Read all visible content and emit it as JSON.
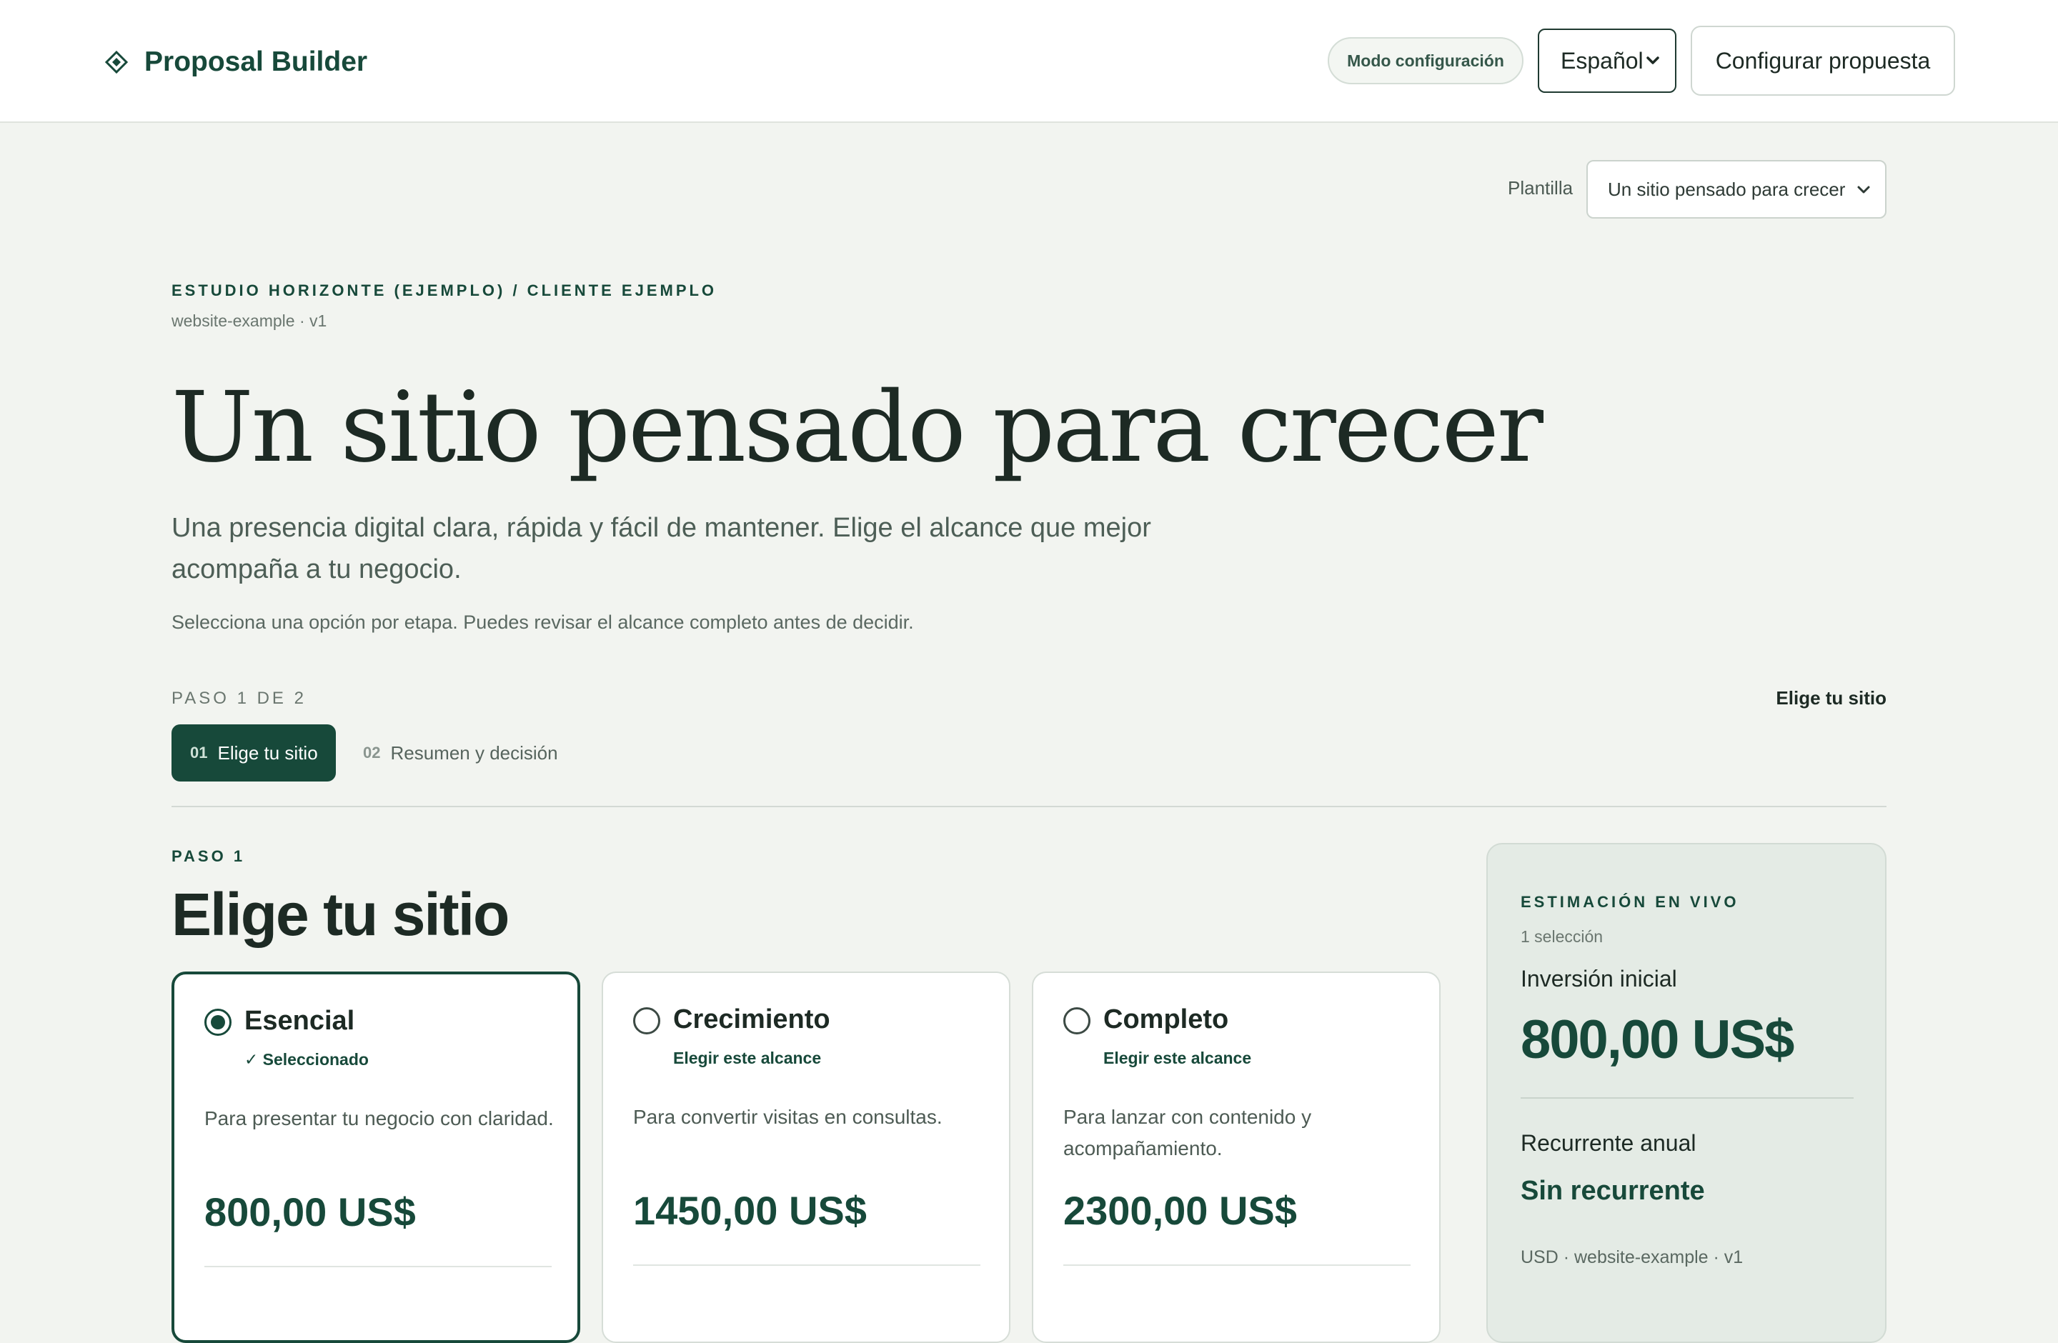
{
  "header": {
    "brand": "Proposal Builder",
    "mode_label": "Modo configuración",
    "language": "Español",
    "config_button": "Configurar propuesta"
  },
  "template": {
    "label": "Plantilla",
    "selected": "Un sitio pensado para crecer"
  },
  "hero": {
    "eyebrow": "ESTUDIO HORIZONTE (EJEMPLO) / CLIENTE EJEMPLO",
    "meta": "website-example · v1",
    "title": "Un sitio pensado para crecer",
    "subtitle": "Una presencia digital clara, rápida y fácil de mantener. Elige el alcance que mejor acompaña a tu negocio.",
    "note": "Selecciona una opción por etapa. Puedes revisar el alcance completo antes de decidir."
  },
  "steps": {
    "count": "PASO 1 DE 2",
    "current_label": "Elige tu sitio",
    "tabs": [
      {
        "num": "01",
        "label": "Elige tu sitio",
        "active": true
      },
      {
        "num": "02",
        "label": "Resumen y decisión",
        "active": false
      }
    ]
  },
  "section": {
    "paso": "PASO 1",
    "title": "Elige tu sitio"
  },
  "options": [
    {
      "name": "Esencial",
      "status": "✓ Seleccionado",
      "description": "Para presentar tu negocio con claridad.",
      "price": "800,00 US$",
      "selected": true
    },
    {
      "name": "Crecimiento",
      "status": "Elegir este alcance",
      "description": "Para convertir visitas en consultas.",
      "price": "1450,00 US$",
      "selected": false
    },
    {
      "name": "Completo",
      "status": "Elegir este alcance",
      "description": "Para lanzar con contenido y acompañamiento.",
      "price": "2300,00 US$",
      "selected": false
    }
  ],
  "estimate": {
    "label": "ESTIMACIÓN EN VIVO",
    "count": "1 selección",
    "initial_label": "Inversión inicial",
    "initial_value": "800,00 US$",
    "recurring_label": "Recurrente anual",
    "recurring_value": "Sin recurrente",
    "footer": "USD · website-example · v1"
  },
  "colors": {
    "brand": "#17493a",
    "background": "#f2f4f0",
    "panel": "#e4ebe5"
  }
}
